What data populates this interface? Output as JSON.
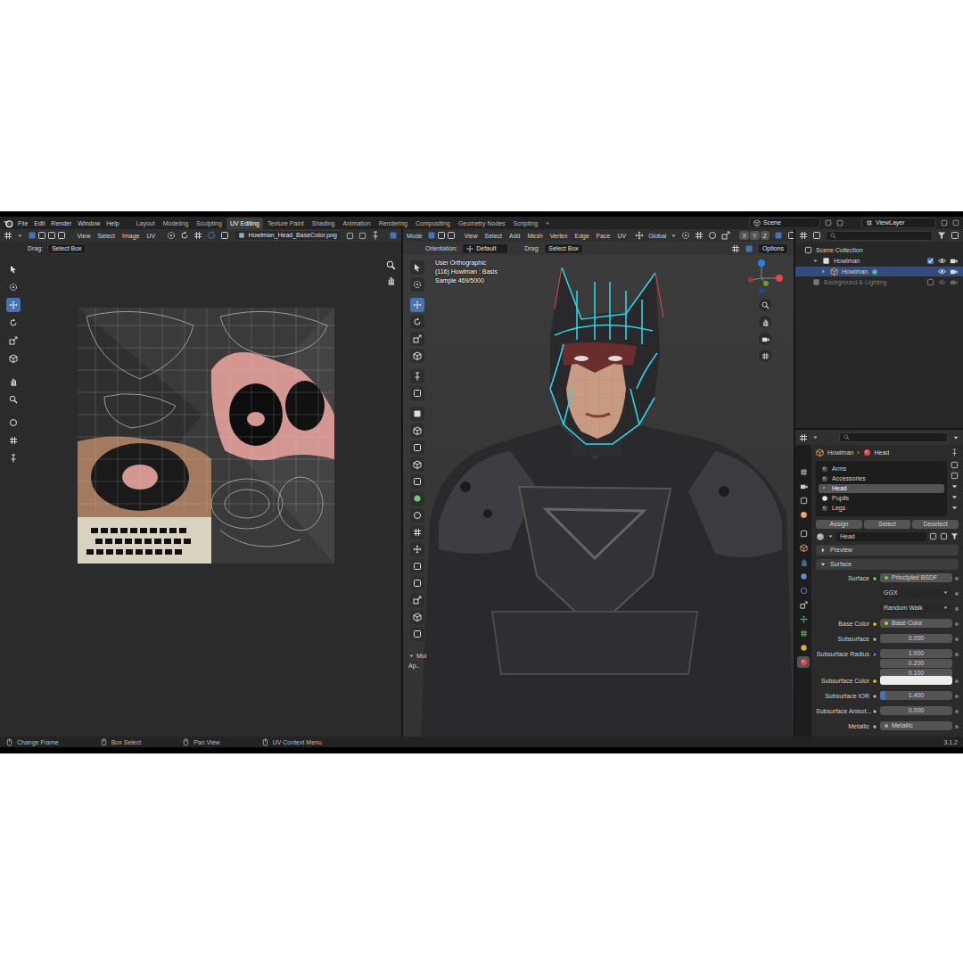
{
  "topbar": {
    "menus": [
      "File",
      "Edit",
      "Render",
      "Window",
      "Help"
    ],
    "workspaces": [
      {
        "label": "Layout",
        "selected": false
      },
      {
        "label": "Modeling",
        "selected": false
      },
      {
        "label": "Sculpting",
        "selected": false
      },
      {
        "label": "UV Editing",
        "selected": true
      },
      {
        "label": "Texture Paint",
        "selected": false
      },
      {
        "label": "Shading",
        "selected": false
      },
      {
        "label": "Animation",
        "selected": false
      },
      {
        "label": "Rendering",
        "selected": false
      },
      {
        "label": "Compositing",
        "selected": false
      },
      {
        "label": "Geometry Nodes",
        "selected": false
      },
      {
        "label": "Scripting",
        "selected": false
      }
    ],
    "add_workspace": "+",
    "scene": "Scene",
    "view_layer": "ViewLayer"
  },
  "uv_editor": {
    "menus": [
      "View",
      "Select",
      "Image",
      "UV"
    ],
    "image_name": "Howlman_Head_BaseColor.png",
    "drag_label": "Drag:",
    "drag_value": "Select Box",
    "tools": [
      {
        "selected": false
      },
      {
        "selected": false
      },
      {
        "selected": true
      },
      {
        "selected": false
      },
      {
        "selected": false
      },
      {
        "selected": false
      },
      {
        "selected": false
      },
      {
        "selected": false
      },
      {
        "selected": false
      },
      {
        "selected": false
      },
      {
        "selected": false
      }
    ]
  },
  "viewport": {
    "mode": "Mode",
    "menus": [
      "View",
      "Select",
      "Add",
      "Mesh",
      "Vertex",
      "Edge",
      "Face",
      "UV"
    ],
    "transform": "Global",
    "axes": [
      "X",
      "Y",
      "Z"
    ],
    "orientation_label": "Orientation:",
    "orientation": "Default",
    "drag_label": "Drag:",
    "drag_value": "Select Box",
    "options": "Options",
    "overlay": [
      "User Orthographic",
      "(116) Howlman : Basis",
      "Sample 469/5000"
    ],
    "tools": [
      {
        "selected": false
      },
      {
        "selected": false
      },
      {
        "selected": true
      },
      {
        "selected": false
      },
      {
        "selected": false
      },
      {
        "selected": false
      },
      {
        "selected": false
      },
      {
        "selected": false
      },
      {
        "selected": false
      },
      {
        "selected": false
      },
      {
        "selected": false
      },
      {
        "selected": false
      },
      {
        "selected": false
      },
      {
        "selected": false
      },
      {
        "selected": false
      },
      {
        "selected": false
      },
      {
        "selected": false
      },
      {
        "selected": false
      },
      {
        "selected": false
      },
      {
        "selected": false
      },
      {
        "selected": false
      },
      {
        "selected": false
      }
    ],
    "tool_panel": {
      "label": "Mul",
      "button": "Ap.."
    }
  },
  "outliner": {
    "items": [
      {
        "label": "Scene Collection",
        "kind": "scene",
        "depth": 0,
        "selected": false,
        "disabled": false
      },
      {
        "label": "Howlman",
        "kind": "collection",
        "depth": 1,
        "selected": false,
        "disabled": false,
        "checked": true
      },
      {
        "label": "Howlman",
        "kind": "object",
        "depth": 2,
        "selected": true,
        "disabled": false
      },
      {
        "label": "Background & Lighting",
        "kind": "collection",
        "depth": 1,
        "selected": false,
        "disabled": true,
        "checked": false
      }
    ]
  },
  "properties": {
    "breadcrumb": [
      "Howlman",
      "›",
      "Head"
    ],
    "tabs": [
      {
        "selected": false
      },
      {
        "selected": false
      },
      {
        "selected": false
      },
      {
        "selected": false
      },
      {
        "selected": false
      },
      {
        "selected": false
      },
      {
        "selected": false
      },
      {
        "selected": false
      },
      {
        "selected": false
      },
      {
        "selected": false
      },
      {
        "selected": false
      },
      {
        "selected": false
      },
      {
        "selected": false
      },
      {
        "selected": true
      }
    ],
    "slots": [
      {
        "label": "Arms",
        "selected": false
      },
      {
        "label": "Accessories",
        "selected": false
      },
      {
        "label": "Head",
        "selected": true
      },
      {
        "label": "Pupils",
        "selected": false
      },
      {
        "label": "Legs",
        "selected": false
      }
    ],
    "slot_buttons": [
      "Assign",
      "Select",
      "Deselect"
    ],
    "material_name": "Head",
    "sections": [
      {
        "label": "Preview",
        "expanded": false
      },
      {
        "label": "Surface",
        "expanded": true
      }
    ],
    "rows": [
      {
        "kind": "socket",
        "label": "Surface",
        "value": "Principled BSDF",
        "color": "#63c763"
      },
      {
        "kind": "dropdown",
        "value": "GGX"
      },
      {
        "kind": "dropdown",
        "value": "Random Walk"
      },
      {
        "kind": "socket",
        "label": "Base Color",
        "value": "Base Color",
        "color": "#c7c729"
      },
      {
        "kind": "number",
        "label": "Subsurface",
        "value": "0.000",
        "color": "#a1a1a1"
      },
      {
        "kind": "vector",
        "label": "Subsurface Radius",
        "values": [
          "1.000",
          "0.200",
          "0.100"
        ],
        "color": "#6363c7"
      },
      {
        "kind": "swatch",
        "label": "Subsurface Color",
        "swatch": "#eeeeee",
        "color": "#c7c729"
      },
      {
        "kind": "slider",
        "label": "Subsurface IOR",
        "value": "1.400",
        "level": 0.08,
        "color": "#a1a1a1"
      },
      {
        "kind": "number",
        "label": "Subsurface Anisot...",
        "value": "0.000",
        "color": "#a1a1a1"
      },
      {
        "kind": "socket",
        "label": "Metallic",
        "value": "Metallic",
        "color": "#a1a1a1"
      }
    ]
  },
  "status_bar": {
    "items": [
      "Change Frame",
      "Box Select",
      "Pan View",
      "UV Context Menu"
    ],
    "version": "3.1.2"
  }
}
